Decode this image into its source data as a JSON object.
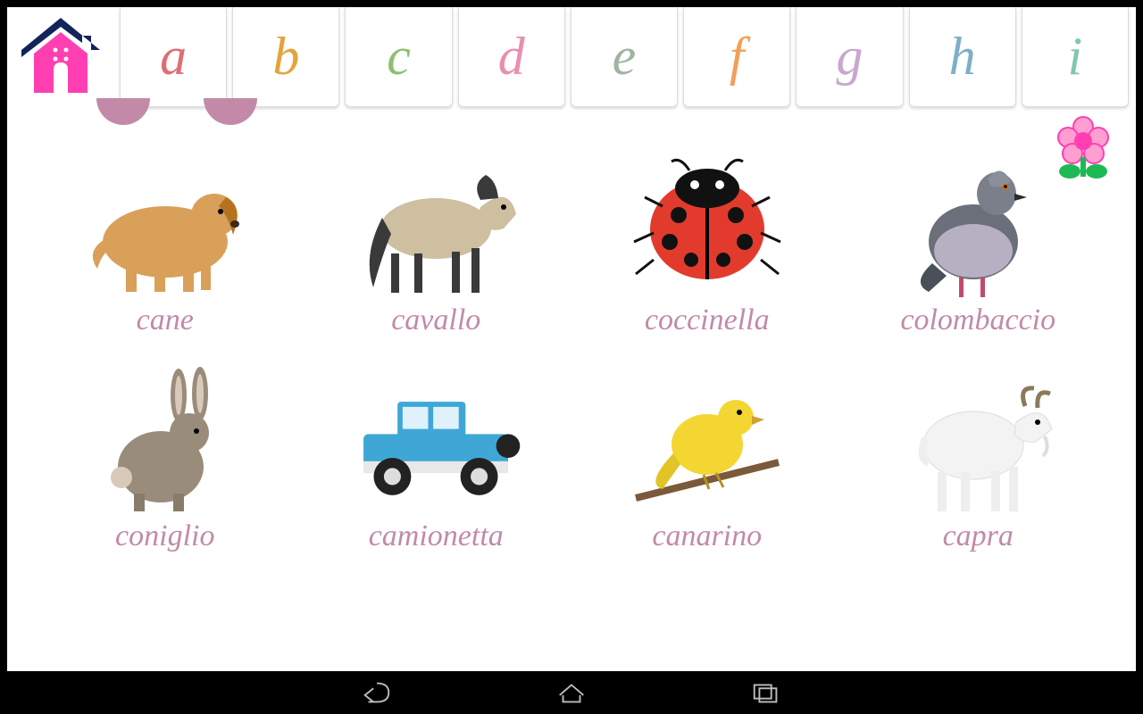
{
  "tabs": [
    {
      "letter": "a",
      "color": "#e06c75"
    },
    {
      "letter": "b",
      "color": "#e5a33b"
    },
    {
      "letter": "c",
      "color": "#8fbf6f"
    },
    {
      "letter": "d",
      "color": "#e88fb0"
    },
    {
      "letter": "e",
      "color": "#a0b49f"
    },
    {
      "letter": "f",
      "color": "#f0a05a"
    },
    {
      "letter": "g",
      "color": "#c9a7cf"
    },
    {
      "letter": "h",
      "color": "#7db0c8"
    },
    {
      "letter": "i",
      "color": "#7ec9a9"
    }
  ],
  "cards": [
    {
      "label": "cane",
      "icon": "dog"
    },
    {
      "label": "cavallo",
      "icon": "horse"
    },
    {
      "label": "coccinella",
      "icon": "ladybug"
    },
    {
      "label": "colombaccio",
      "icon": "pigeon"
    },
    {
      "label": "coniglio",
      "icon": "rabbit"
    },
    {
      "label": "camionetta",
      "icon": "jeep"
    },
    {
      "label": "canarino",
      "icon": "canary"
    },
    {
      "label": "capra",
      "icon": "goat"
    }
  ],
  "label_color": "#c28aa8"
}
